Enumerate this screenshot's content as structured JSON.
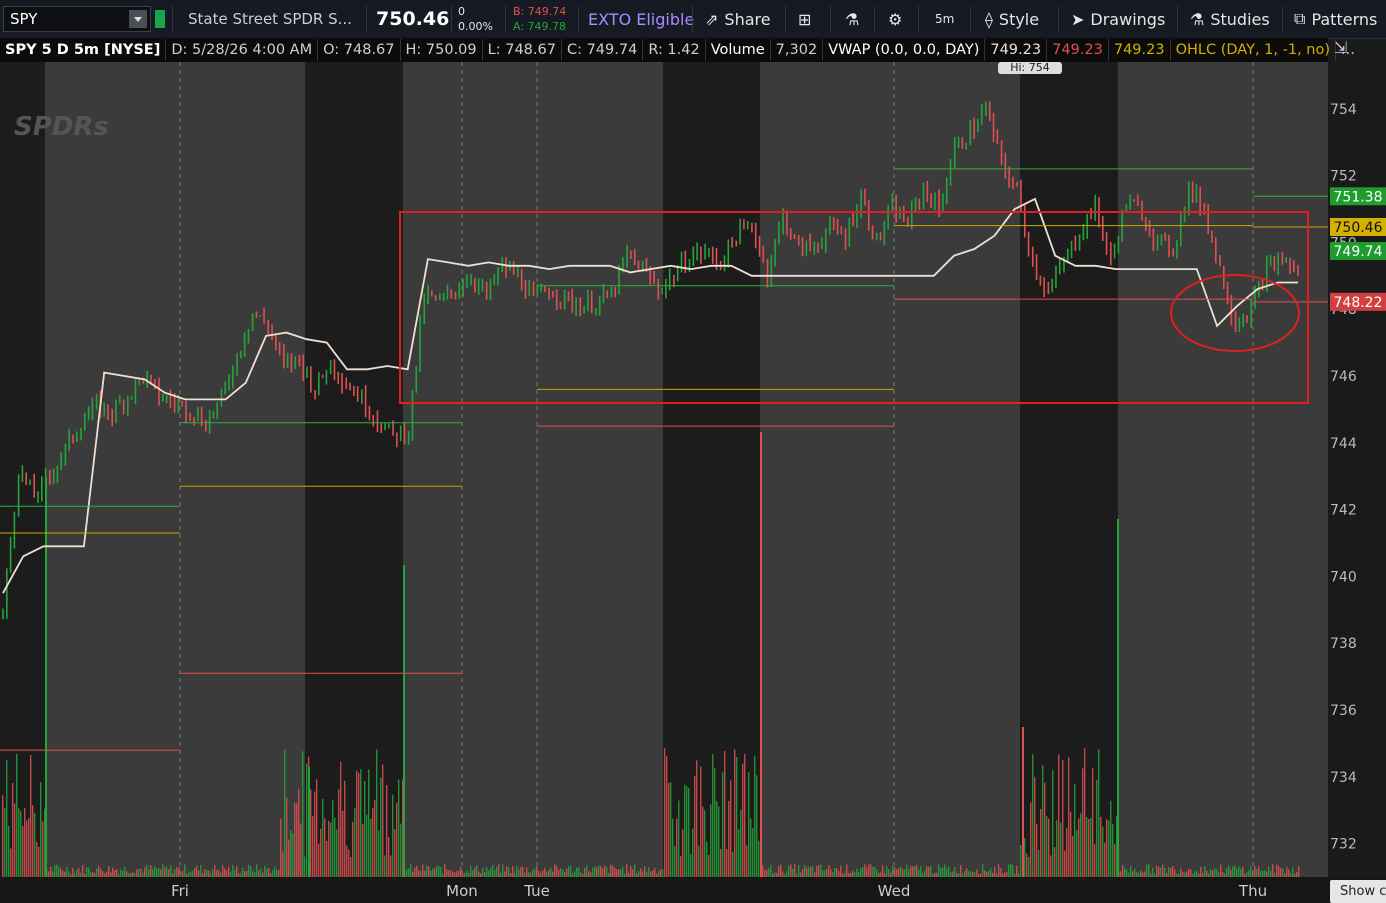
{
  "toolbar": {
    "symbol": "SPY",
    "description": "State Street SPDR S...",
    "last": "750.46",
    "change": "0",
    "change_pct": "0.00%",
    "bid": "B: 749.74",
    "ask": "A: 749.78",
    "exto": "EXTO Eligible",
    "share": "Share",
    "interval": "5m",
    "style": "Style",
    "drawings": "Drawings",
    "studies": "Studies",
    "patterns": "Patterns",
    "icons": [
      "dropdown-icon",
      "share-icon",
      "flask-icon",
      "gear-icon",
      "style-icon",
      "cursor-icon",
      "studies-flask-icon",
      "patterns-icon",
      "compare-icon"
    ]
  },
  "header": {
    "title": "SPY 5 D 5m [NYSE]",
    "cells": [
      "D: 5/28/26 4:00 AM",
      "O: 748.67",
      "H: 750.09",
      "L: 748.67",
      "C: 749.74",
      "R: 1.42",
      "Volume",
      "7,302",
      "VWAP (0.0, 0.0, DAY)",
      "749.23",
      "749.23",
      "749.23",
      "OHLC (DAY, 1, -1, no)",
      "..."
    ]
  },
  "watermark": "SPDRs",
  "show_button": "Show c",
  "colors": {
    "up": "#26a33a",
    "down": "#e05050",
    "vwap": "#f0ded0",
    "bg_light": "#3b3b3b",
    "bg_dark": "#1c1c1c",
    "red_box": "#e02020",
    "yellow": "#d4b000"
  },
  "chart_data": {
    "type": "line",
    "ylim": [
      731,
      755.4
    ],
    "yticks": [
      754,
      752,
      750,
      748,
      746,
      744,
      742,
      740,
      738,
      736,
      734,
      732
    ],
    "x_labels": [
      "Fri",
      "Mon",
      "Tue",
      "Wed",
      "Thu"
    ],
    "high_label": "Hi: 754",
    "price_badges": [
      {
        "value": "751.38",
        "color": "#1e9c2e"
      },
      {
        "value": "750.46",
        "color": "#d4b000"
      },
      {
        "value": "749.74",
        "color": "#1e9c2e"
      },
      {
        "value": "748.22",
        "color": "#d04040"
      }
    ],
    "series": [
      {
        "name": "SPY",
        "price": [
          738.9,
          743.2,
          742.4,
          743.0,
          743.8,
          744.6,
          745.1,
          744.9,
          745.4,
          746.0,
          745.4,
          745.2,
          745.0,
          744.6,
          745.3,
          746.6,
          747.9,
          747.5,
          746.3,
          746.5,
          745.6,
          746.4,
          745.8,
          745.3,
          744.7,
          744.2,
          744.4,
          748.4,
          748.2,
          748.6,
          749.0,
          748.4,
          749.3,
          749.0,
          748.3,
          748.6,
          748.3,
          748.1,
          748.2,
          748.4,
          749.6,
          749.2,
          748.6,
          749.0,
          749.6,
          749.7,
          749.4,
          750.2,
          750.5,
          749.1,
          750.8,
          749.8,
          749.9,
          750.4,
          750.2,
          751.4,
          750.0,
          751.0,
          750.6,
          751.6,
          751.0,
          752.8,
          753.3,
          754.0,
          752.4,
          751.5,
          749.4,
          748.5,
          749.4,
          750.3,
          751.1,
          749.4,
          751.2,
          750.9,
          750.0,
          749.8,
          751.6,
          751.0,
          749.2,
          747.6,
          748.0,
          749.2,
          749.5,
          749.1
        ]
      },
      {
        "name": "VWAP",
        "vwap": [
          739.5,
          740.6,
          740.9,
          740.9,
          740.9,
          746.1,
          746.0,
          745.9,
          745.5,
          745.3,
          745.3,
          745.3,
          745.8,
          747.2,
          747.3,
          747.1,
          747.0,
          746.2,
          746.2,
          746.3,
          746.2,
          749.5,
          749.4,
          749.3,
          749.4,
          749.3,
          749.3,
          749.2,
          749.3,
          749.3,
          749.3,
          749.1,
          749.2,
          749.3,
          749.2,
          749.3,
          749.3,
          749.0,
          749.0,
          749.0,
          749.0,
          749.0,
          749.0,
          749.0,
          749.0,
          749.0,
          749.0,
          749.6,
          749.8,
          750.2,
          751.0,
          751.3,
          749.6,
          749.3,
          749.3,
          749.2,
          749.2,
          749.2,
          749.2,
          749.2,
          747.5,
          748.1,
          748.6,
          748.8,
          748.8
        ]
      }
    ],
    "levels": [
      {
        "from": "Fri",
        "y": 744.6,
        "color": "green"
      },
      {
        "from": "Fri",
        "y": 742.7,
        "color": "yellow"
      },
      {
        "from": "Fri",
        "y": 737.1,
        "color": "red"
      },
      {
        "from": "Tue",
        "y": 748.7,
        "color": "green"
      },
      {
        "from": "Tue",
        "y": 745.6,
        "color": "yellow"
      },
      {
        "from": "Tue",
        "y": 744.5,
        "color": "red"
      },
      {
        "from": "Wed",
        "y": 752.2,
        "color": "green"
      },
      {
        "from": "Wed",
        "y": 750.5,
        "color": "yellow"
      },
      {
        "from": "Wed",
        "y": 748.3,
        "color": "red"
      }
    ],
    "grid": true
  }
}
